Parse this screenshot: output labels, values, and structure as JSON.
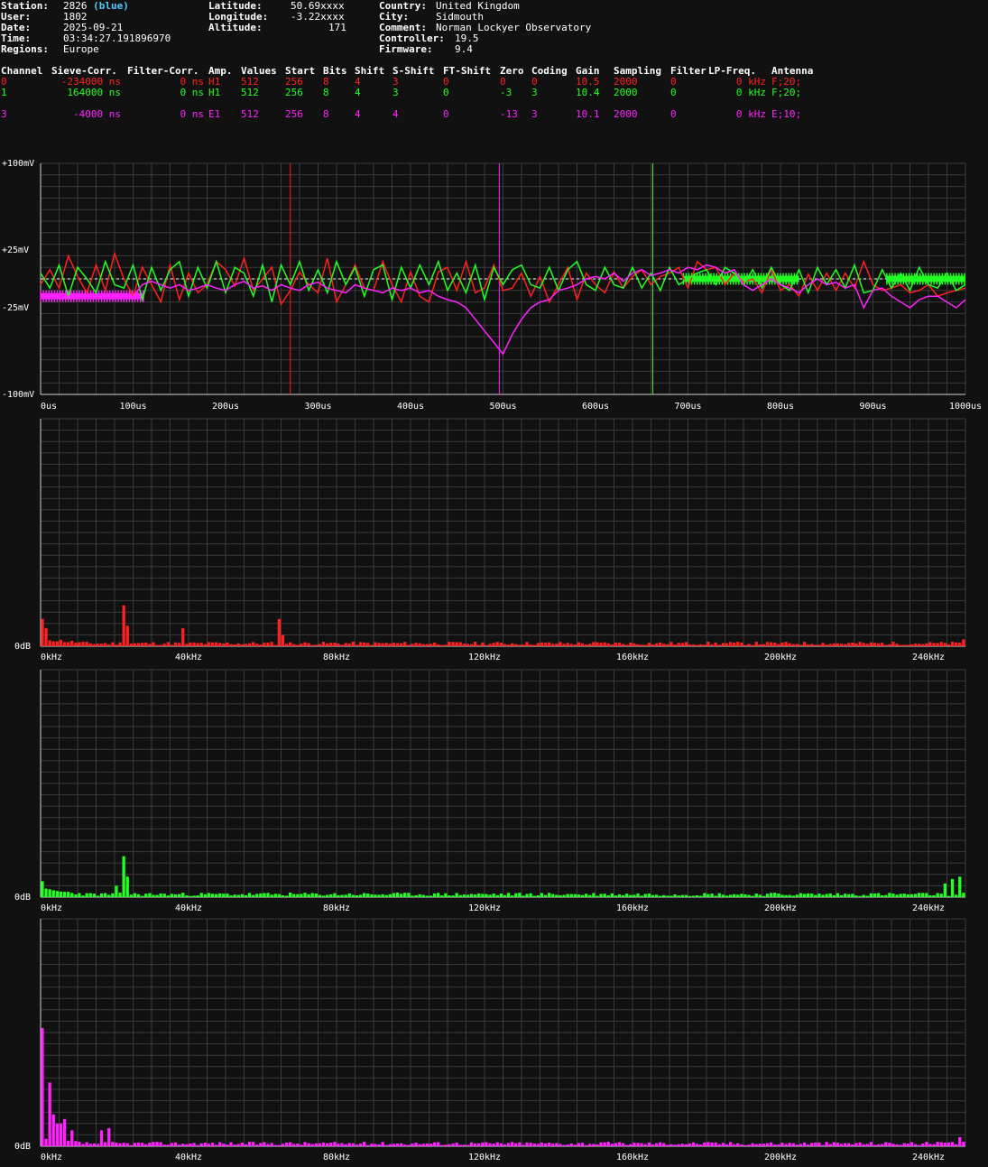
{
  "station_info": {
    "station_label": "Station:",
    "station_value": "2826",
    "station_color_name": "(blue)",
    "user_label": "User:",
    "user_value": "1802",
    "date_label": "Date:",
    "date_value": "2025-09-21",
    "time_label": "Time:",
    "time_value": "03:34:27.191896970",
    "regions_label": "Regions:",
    "regions_value": "Europe",
    "latitude_label": "Latitude:",
    "latitude_value": "50.69xxxx",
    "longitude_label": "Longitude:",
    "longitude_value": "-3.22xxxx",
    "altitude_label": "Altitude:",
    "altitude_value": "171",
    "country_label": "Country:",
    "country_value": "United Kingdom",
    "city_label": "City:",
    "city_value": "Sidmouth",
    "comment_label": "Comment:",
    "comment_value": "Norman Lockyer Observatory",
    "controller_label": "Controller:",
    "controller_value": "19.5",
    "firmware_label": "Firmware:",
    "firmware_value": "9.4"
  },
  "channel_table": {
    "headers": [
      "Channel",
      "Sieve-Corr.",
      "Filter-Corr.",
      "Amp.",
      "Values",
      "Start",
      "Bits",
      "Shift",
      "S-Shift",
      "FT-Shift",
      "Zero",
      "Coding",
      "Gain",
      "Sampling",
      "Filter",
      "LP-Freq.",
      "Antenna"
    ],
    "rows": [
      {
        "color": "#ff2020",
        "cells": [
          "0",
          "-234000 ns",
          "0 ns",
          "H1",
          "512",
          "256",
          "8",
          "4",
          "3",
          "0",
          "0",
          "0",
          "10.5",
          "2000",
          "0",
          "0 kHz",
          "F;20;"
        ]
      },
      {
        "color": "#22ff22",
        "cells": [
          "1",
          "164000 ns",
          "0 ns",
          "H1",
          "512",
          "256",
          "8",
          "4",
          "3",
          "0",
          "-3",
          "3",
          "10.4",
          "2000",
          "0",
          "0 kHz",
          "F;20;"
        ]
      },
      {
        "color": "#ff22ff",
        "cells": [
          "3",
          "-4000 ns",
          "0 ns",
          "E1",
          "512",
          "256",
          "8",
          "4",
          "4",
          "0",
          "-13",
          "3",
          "10.1",
          "2000",
          "0",
          "0 kHz",
          "E;10;"
        ]
      }
    ]
  },
  "colors": {
    "ch0": "#ff2020",
    "ch1": "#22ff22",
    "ch3": "#ff22ff",
    "grid": "#3a3a3a",
    "axis": "#cfcfcf",
    "bg": "#111111"
  },
  "chart_data": [
    {
      "type": "line",
      "ylim": [
        -100,
        100
      ],
      "xlim": [
        0,
        1000
      ],
      "y_ticks": [
        {
          "v": 100,
          "label": "+100mV"
        },
        {
          "v": 25,
          "label": "+25mV"
        },
        {
          "v": -25,
          "label": "-25mV"
        },
        {
          "v": -100,
          "label": "-100mV"
        }
      ],
      "x_ticks": [
        {
          "v": 0,
          "label": "0us"
        },
        {
          "v": 100,
          "label": "100us"
        },
        {
          "v": 200,
          "label": "200us"
        },
        {
          "v": 300,
          "label": "300us"
        },
        {
          "v": 400,
          "label": "400us"
        },
        {
          "v": 500,
          "label": "500us"
        },
        {
          "v": 600,
          "label": "600us"
        },
        {
          "v": 700,
          "label": "700us"
        },
        {
          "v": 800,
          "label": "800us"
        },
        {
          "v": 900,
          "label": "900us"
        },
        {
          "v": 1000,
          "label": "1000us"
        }
      ],
      "markers": [
        {
          "x": 270,
          "color": "#ff2020"
        },
        {
          "x": 496,
          "color": "#ff22ff"
        },
        {
          "x": 662,
          "color": "#22ff22"
        }
      ],
      "series": [
        {
          "color": "#ff2020",
          "x": [
            0,
            10,
            20,
            30,
            40,
            50,
            60,
            70,
            80,
            90,
            100,
            110,
            120,
            130,
            140,
            150,
            160,
            170,
            180,
            190,
            200,
            210,
            220,
            230,
            240,
            250,
            260,
            270,
            280,
            290,
            300,
            310,
            320,
            330,
            340,
            350,
            360,
            370,
            380,
            390,
            400,
            410,
            420,
            430,
            440,
            450,
            460,
            470,
            480,
            490,
            500,
            510,
            520,
            530,
            540,
            550,
            560,
            570,
            580,
            590,
            600,
            610,
            620,
            630,
            640,
            650,
            660,
            670,
            680,
            690,
            700,
            710,
            720,
            730,
            740,
            750,
            760,
            770,
            780,
            790,
            800,
            810,
            820,
            830,
            840,
            850,
            860,
            870,
            880,
            890,
            900,
            910,
            920,
            930,
            940,
            950,
            960,
            970,
            980,
            990,
            1000
          ],
          "y": [
            -5,
            8,
            -8,
            20,
            2,
            -12,
            12,
            -10,
            22,
            0,
            -15,
            10,
            -5,
            -20,
            12,
            -18,
            5,
            -12,
            -5,
            15,
            8,
            -6,
            18,
            -10,
            0,
            10,
            -22,
            -10,
            6,
            -5,
            -12,
            18,
            -20,
            -5,
            12,
            -8,
            -10,
            15,
            -5,
            -20,
            6,
            -15,
            -20,
            6,
            10,
            -10,
            15,
            -12,
            -8,
            12,
            -10,
            -8,
            5,
            -15,
            2,
            -20,
            -5,
            10,
            -18,
            5,
            -5,
            -12,
            6,
            -8,
            2,
            8,
            -5,
            2,
            5,
            10,
            -8,
            15,
            8,
            10,
            -5,
            5,
            -3,
            0,
            -12,
            8,
            -10,
            -5,
            -15,
            4,
            -10,
            5,
            -10,
            5,
            -8,
            15,
            -5,
            -10,
            -8,
            -5,
            -12,
            -10,
            -5,
            -15,
            -12,
            -10,
            -8
          ]
        },
        {
          "color": "#22ff22",
          "x": [
            0,
            10,
            20,
            30,
            40,
            50,
            60,
            70,
            80,
            90,
            100,
            110,
            120,
            130,
            140,
            150,
            160,
            170,
            180,
            190,
            200,
            210,
            220,
            230,
            240,
            250,
            260,
            270,
            280,
            290,
            300,
            310,
            320,
            330,
            340,
            350,
            360,
            370,
            380,
            390,
            400,
            410,
            420,
            430,
            440,
            450,
            460,
            470,
            480,
            490,
            500,
            510,
            520,
            530,
            540,
            550,
            560,
            570,
            580,
            590,
            600,
            610,
            620,
            630,
            640,
            650,
            660,
            670,
            680,
            690,
            700,
            710,
            720,
            730,
            740,
            750,
            760,
            770,
            780,
            790,
            800,
            810,
            820,
            830,
            840,
            850,
            860,
            870,
            880,
            890,
            900,
            910,
            920,
            930,
            940,
            950,
            960,
            970,
            980,
            990,
            1000
          ],
          "y": [
            5,
            -8,
            12,
            -15,
            10,
            0,
            -12,
            15,
            -5,
            -8,
            12,
            -18,
            10,
            -10,
            8,
            15,
            -15,
            10,
            -8,
            15,
            -12,
            10,
            5,
            -15,
            12,
            -20,
            12,
            -5,
            15,
            -10,
            8,
            -12,
            15,
            -5,
            10,
            -15,
            8,
            12,
            -18,
            10,
            -8,
            12,
            -5,
            15,
            -10,
            5,
            -12,
            12,
            -18,
            10,
            -5,
            8,
            12,
            -5,
            -8,
            10,
            -10,
            8,
            15,
            -5,
            -10,
            10,
            -5,
            -8,
            10,
            -8,
            5,
            -10,
            10,
            -5,
            0,
            5,
            8,
            -5,
            10,
            5,
            -5,
            8,
            -8,
            10,
            -5,
            -10,
            8,
            -12,
            10,
            -5,
            8,
            -8,
            12,
            -12,
            -10,
            8,
            -8,
            5,
            -10,
            10,
            -5,
            -8,
            5,
            -10,
            -5
          ]
        },
        {
          "color": "#ff22ff",
          "x": [
            0,
            10,
            20,
            30,
            40,
            50,
            60,
            70,
            80,
            90,
            100,
            110,
            120,
            130,
            140,
            150,
            160,
            170,
            180,
            190,
            200,
            210,
            220,
            230,
            240,
            250,
            260,
            270,
            280,
            290,
            300,
            310,
            320,
            330,
            340,
            350,
            360,
            370,
            380,
            390,
            400,
            410,
            420,
            430,
            440,
            450,
            460,
            470,
            480,
            490,
            500,
            510,
            520,
            530,
            540,
            550,
            560,
            570,
            580,
            590,
            600,
            610,
            620,
            630,
            640,
            650,
            660,
            670,
            680,
            690,
            700,
            710,
            720,
            730,
            740,
            750,
            760,
            770,
            780,
            790,
            800,
            810,
            820,
            830,
            840,
            850,
            860,
            870,
            880,
            890,
            900,
            910,
            920,
            930,
            940,
            950,
            960,
            970,
            980,
            990,
            1000
          ],
          "y": [
            -15,
            -15,
            -15,
            -15,
            -15,
            -15,
            -15,
            -15,
            -15,
            -15,
            -15,
            -5,
            -2,
            -5,
            -8,
            -5,
            -10,
            -8,
            -5,
            -8,
            -10,
            -5,
            -2,
            -8,
            -6,
            -10,
            -5,
            -8,
            -10,
            -5,
            -3,
            -8,
            -10,
            -12,
            -5,
            -8,
            -10,
            -12,
            -8,
            -10,
            -8,
            -12,
            -10,
            -15,
            -18,
            -20,
            -25,
            -35,
            -45,
            -55,
            -65,
            -48,
            -35,
            -25,
            -20,
            -18,
            -10,
            -8,
            -5,
            0,
            2,
            0,
            5,
            -2,
            5,
            8,
            3,
            5,
            8,
            5,
            10,
            8,
            12,
            10,
            5,
            8,
            -5,
            -10,
            -5,
            0,
            -5,
            -8,
            -12,
            -5,
            0,
            -5,
            -3,
            -8,
            -5,
            -25,
            -10,
            -8,
            -15,
            -20,
            -25,
            -18,
            -15,
            -15,
            -20,
            -25,
            -18
          ]
        }
      ],
      "bands": [
        {
          "color": "#ff22ff",
          "x0": 0,
          "x1": 112,
          "y0": -10,
          "y1": -20
        },
        {
          "color": "#22ff22",
          "x0": 695,
          "x1": 820,
          "y0": 5,
          "y1": -5
        },
        {
          "color": "#22ff22",
          "x0": 915,
          "x1": 1000,
          "y0": 5,
          "y1": -5
        }
      ]
    },
    {
      "type": "bar",
      "color": "#ff2020",
      "ylabel": "0dB",
      "x_ticks": [
        "0kHz",
        "40kHz",
        "80kHz",
        "120kHz",
        "160kHz",
        "200kHz",
        "240kHz"
      ],
      "peaks": [
        {
          "f": 0,
          "v": 0.12
        },
        {
          "f": 1,
          "v": 0.08
        },
        {
          "f": 22,
          "v": 0.18
        },
        {
          "f": 23,
          "v": 0.09
        },
        {
          "f": 38,
          "v": 0.08
        },
        {
          "f": 64,
          "v": 0.12
        },
        {
          "f": 65,
          "v": 0.05
        },
        {
          "f": 249,
          "v": 0.03
        }
      ]
    },
    {
      "type": "bar",
      "color": "#22ff22",
      "ylabel": "0dB",
      "x_ticks": [
        "0kHz",
        "40kHz",
        "80kHz",
        "120kHz",
        "160kHz",
        "200kHz",
        "240kHz"
      ],
      "peaks": [
        {
          "f": 0,
          "v": 0.07
        },
        {
          "f": 22,
          "v": 0.18
        },
        {
          "f": 23,
          "v": 0.09
        },
        {
          "f": 20,
          "v": 0.05
        },
        {
          "f": 244,
          "v": 0.06
        },
        {
          "f": 246,
          "v": 0.08
        },
        {
          "f": 248,
          "v": 0.09
        },
        {
          "f": 250,
          "v": 0.06
        }
      ]
    },
    {
      "type": "bar",
      "color": "#ff22ff",
      "ylabel": "0dB",
      "x_ticks": [
        "0kHz",
        "40kHz",
        "80kHz",
        "120kHz",
        "160kHz",
        "200kHz",
        "240kHz"
      ],
      "peaks": [
        {
          "f": 0,
          "v": 0.52
        },
        {
          "f": 2,
          "v": 0.28
        },
        {
          "f": 3,
          "v": 0.14
        },
        {
          "f": 4,
          "v": 0.1
        },
        {
          "f": 5,
          "v": 0.1
        },
        {
          "f": 6,
          "v": 0.12
        },
        {
          "f": 8,
          "v": 0.07
        },
        {
          "f": 16,
          "v": 0.07
        },
        {
          "f": 18,
          "v": 0.08
        },
        {
          "f": 248,
          "v": 0.04
        },
        {
          "f": 250,
          "v": 0.04
        }
      ]
    }
  ]
}
